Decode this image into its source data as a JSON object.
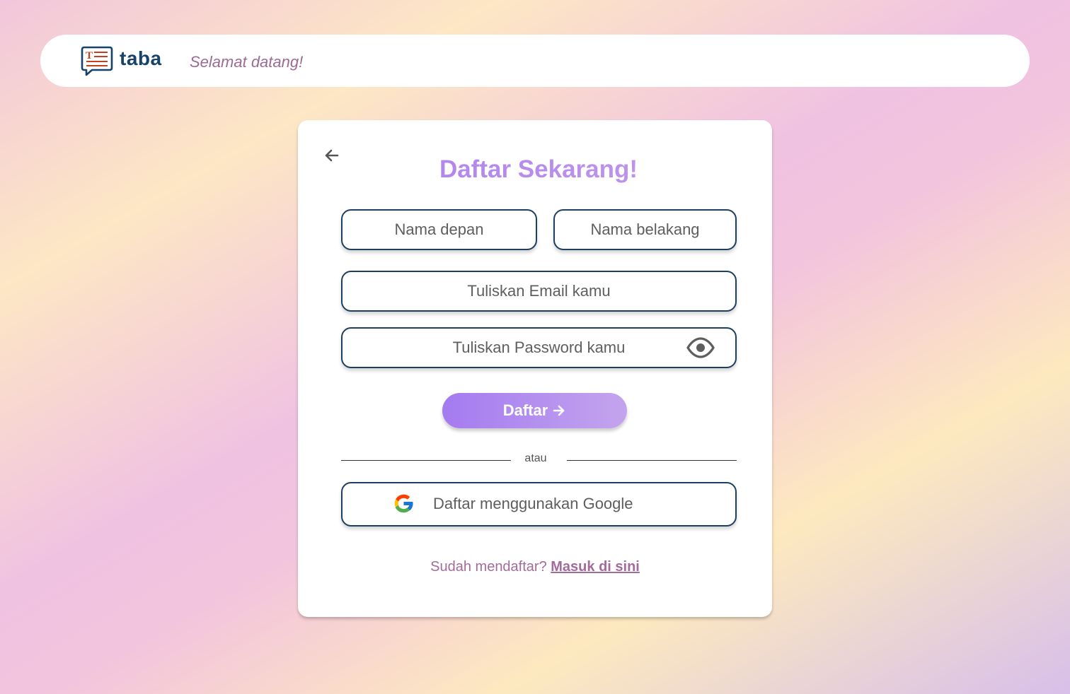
{
  "header": {
    "brand": "taba",
    "welcome": "Selamat datang!",
    "logo_icon": "chat-document-logo-icon"
  },
  "form": {
    "title": "Daftar Sekarang!",
    "back_icon": "arrow-left-icon",
    "first_name_placeholder": "Nama depan",
    "last_name_placeholder": "Nama belakang",
    "email_placeholder": "Tuliskan Email kamu",
    "password_placeholder": "Tuliskan Password kamu",
    "password_toggle_icon": "eye-icon",
    "submit_label": "Daftar",
    "submit_icon": "arrow-right-icon",
    "divider_text": "atau",
    "google_label": "Daftar menggunakan Google",
    "google_icon": "google-icon",
    "footer_prompt": "Sudah mendaftar?",
    "footer_link": "Masuk di sini"
  },
  "colors": {
    "brand_navy": "#17426a",
    "title_purple": "#b184f2",
    "button_gradient_start": "#a47bf0",
    "button_gradient_end": "#c4a4ee",
    "footer_text": "#a36a9b",
    "field_border": "#1d4061"
  }
}
